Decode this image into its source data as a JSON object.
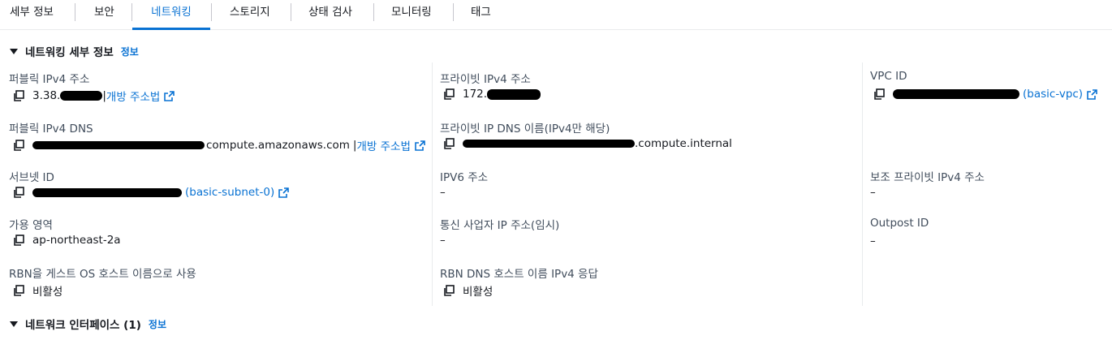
{
  "tabs": [
    {
      "label": "세부 정보",
      "active": false
    },
    {
      "label": "보안",
      "active": false
    },
    {
      "label": "네트워킹",
      "active": true
    },
    {
      "label": "스토리지",
      "active": false
    },
    {
      "label": "상태 검사",
      "active": false
    },
    {
      "label": "모니터링",
      "active": false
    },
    {
      "label": "태그",
      "active": false
    }
  ],
  "networking_details": {
    "title": "네트워킹 세부 정보",
    "info": "정보",
    "public_ipv4": {
      "label": "퍼블릭 IPv4 주소",
      "value_prefix": "3.38.",
      "separator": "|",
      "link": "개방 주소법"
    },
    "private_ipv4": {
      "label": "프라이빗 IPv4 주소",
      "value_prefix": "172."
    },
    "vpc_id": {
      "label": "VPC ID",
      "link": "(basic-vpc)"
    },
    "public_dns": {
      "label": "퍼블릭 IPv4 DNS",
      "value_suffix": "compute.amazonaws.com",
      "separator": "|",
      "link": "개방 주소법"
    },
    "private_dns": {
      "label": "프라이빗 IP DNS 이름(IPv4만 해당)",
      "value_suffix": ".compute.internal"
    },
    "subnet_id": {
      "label": "서브넷 ID",
      "link": "(basic-subnet-0)"
    },
    "ipv6": {
      "label": "IPV6 주소",
      "value": "–"
    },
    "secondary_private_ipv4": {
      "label": "보조 프라이빗 IPv4 주소",
      "value": "–"
    },
    "availability_zone": {
      "label": "가용 영역",
      "value": "ap-northeast-2a"
    },
    "carrier_ip": {
      "label": "통신 사업자 IP 주소(임시)",
      "value": "–"
    },
    "outpost_id": {
      "label": "Outpost ID",
      "value": "–"
    },
    "rbn_hostname": {
      "label": "RBN을 게스트 OS 호스트 이름으로 사용",
      "value": "비활성"
    },
    "rbn_dns": {
      "label": "RBN DNS 호스트 이름 IPv4 응답",
      "value": "비활성"
    }
  },
  "network_interfaces": {
    "title": "네트워크 인터페이스 (1)",
    "info": "정보"
  },
  "icons": {
    "copy": "copy-icon",
    "external": "external-link-icon",
    "caret": "caret-down-icon"
  },
  "colors": {
    "link": "#0972d3",
    "label": "#414d5c",
    "text": "#16191f",
    "divider": "#e9ebed"
  }
}
